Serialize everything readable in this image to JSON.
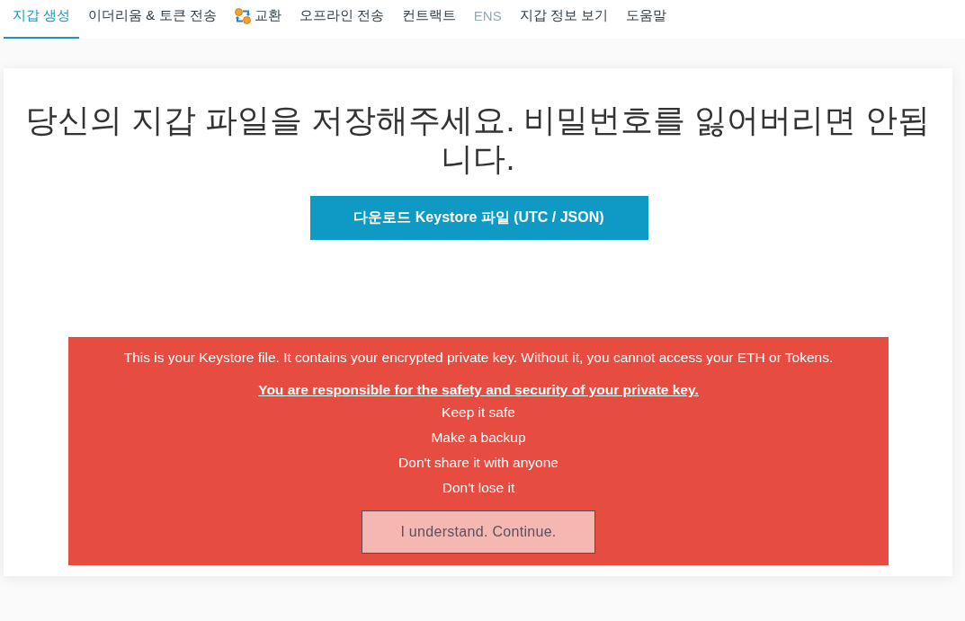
{
  "nav": {
    "tabs": [
      {
        "label": "지갑 생성",
        "selected": true,
        "dimmed": false,
        "icon": false
      },
      {
        "label": "이더리움 & 토큰 전송",
        "selected": false,
        "dimmed": false,
        "icon": false
      },
      {
        "label": "교환",
        "selected": false,
        "dimmed": false,
        "icon": true
      },
      {
        "label": "오프라인 전송",
        "selected": false,
        "dimmed": false,
        "icon": false
      },
      {
        "label": "컨트랙트",
        "selected": false,
        "dimmed": false,
        "icon": false
      },
      {
        "label": "ENS",
        "selected": false,
        "dimmed": true,
        "icon": false
      },
      {
        "label": "지갑 정보 보기",
        "selected": false,
        "dimmed": false,
        "icon": false
      },
      {
        "label": "도움말",
        "selected": false,
        "dimmed": false,
        "icon": false
      }
    ]
  },
  "heading": "당신의 지갑 파일을 저장해주세요. 비밀번호를 잃어버리면 안됩니다.",
  "download_button": "다운로드 Keystore 파일 (UTC / JSON)",
  "warning": {
    "intro": "This is your Keystore file. It contains your encrypted private key. Without it, you cannot access your ETH or Tokens.",
    "responsibility": "You are responsible for the safety and security of your private key.",
    "tips": [
      "Keep it safe",
      "Make a backup",
      "Don't share it with anyone",
      "Don't lose it"
    ],
    "continue_button": "I understand. Continue."
  }
}
